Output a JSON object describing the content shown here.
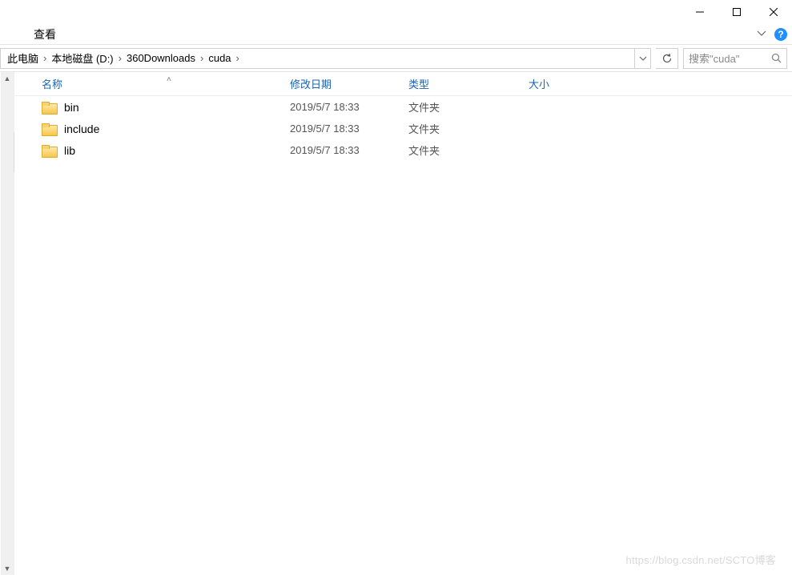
{
  "window": {
    "tab_partial": "",
    "tab_view": "查看"
  },
  "breadcrumb": {
    "segments": [
      "此电脑",
      "本地磁盘 (D:)",
      "360Downloads",
      "cuda"
    ]
  },
  "search": {
    "placeholder": "搜索\"cuda\""
  },
  "columns": {
    "name": "名称",
    "date": "修改日期",
    "type": "类型",
    "size": "大小"
  },
  "rows": [
    {
      "name": "bin",
      "date": "2019/5/7 18:33",
      "type": "文件夹",
      "size": ""
    },
    {
      "name": "include",
      "date": "2019/5/7 18:33",
      "type": "文件夹",
      "size": ""
    },
    {
      "name": "lib",
      "date": "2019/5/7 18:33",
      "type": "文件夹",
      "size": ""
    }
  ],
  "watermark": "https://blog.csdn.net/SCTO博客"
}
